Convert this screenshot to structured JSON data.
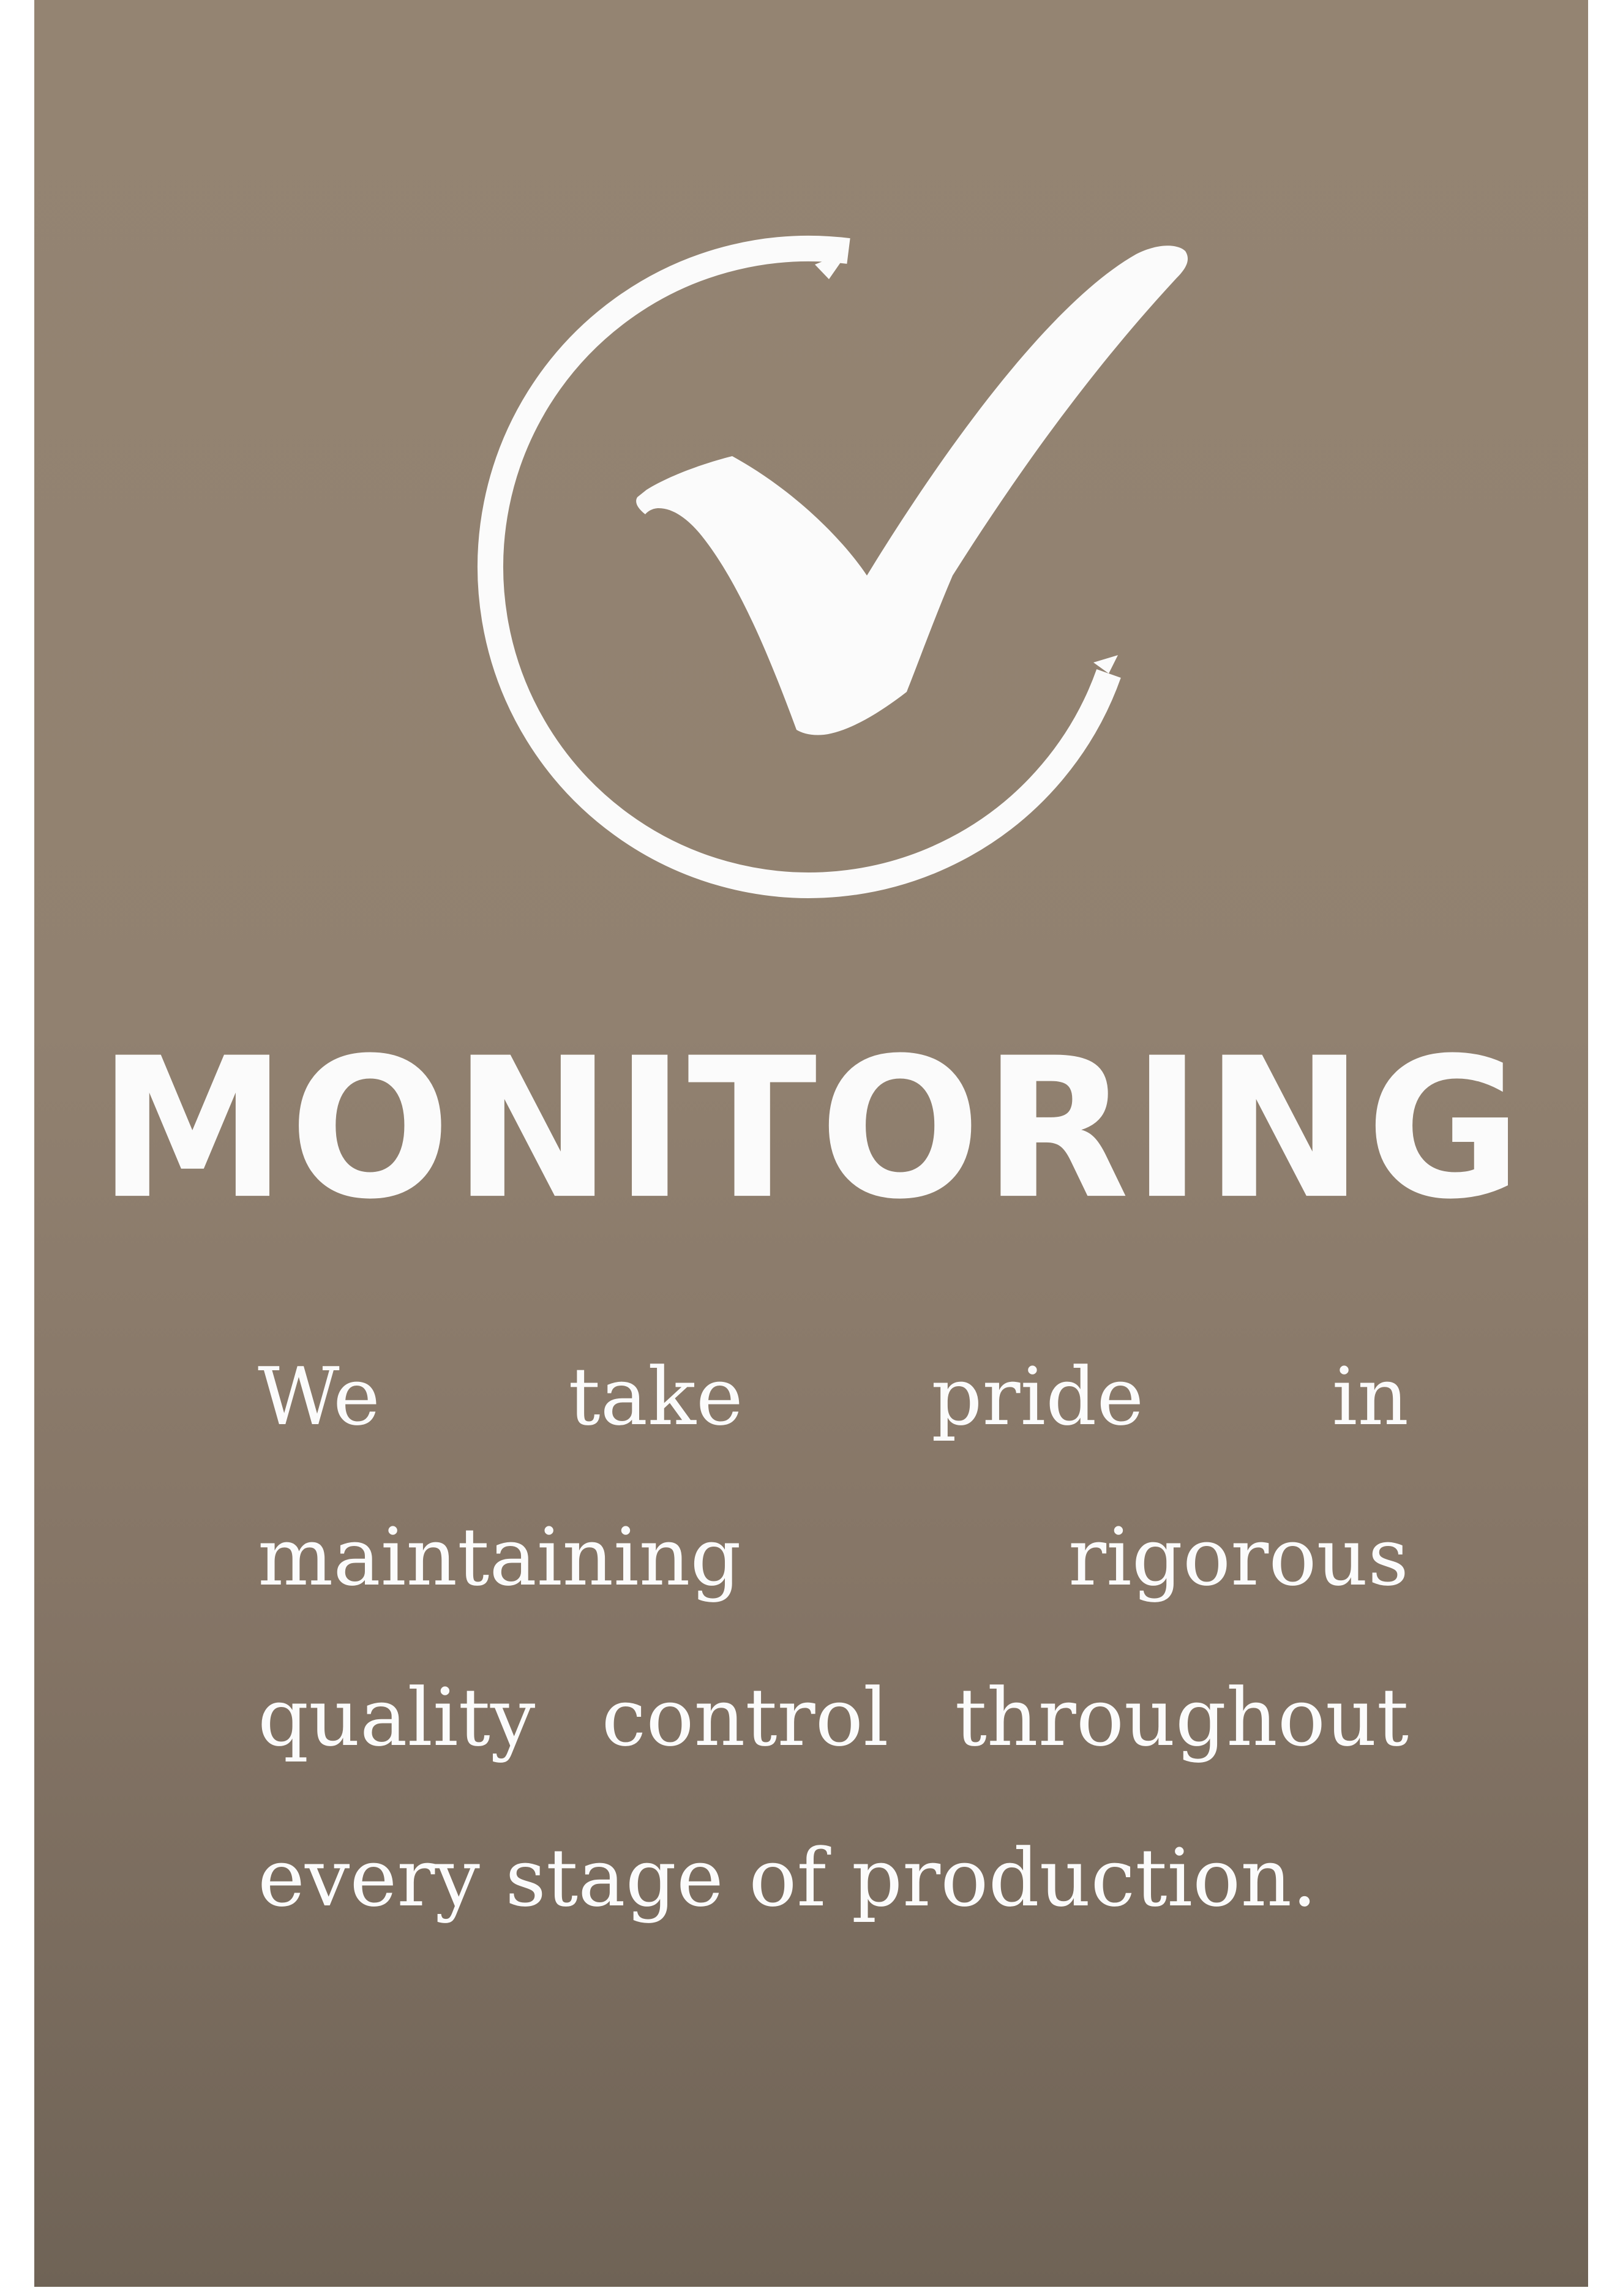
{
  "emblem": {
    "icon": "checkmark-in-circle-icon",
    "color": "#fbfbfb"
  },
  "colors": {
    "background_top": "#948472",
    "background_bottom": "#6f6356",
    "text": "#fbfbfb"
  },
  "title": "MONITORING",
  "description": "We take pride in maintaining rigorous quality control throughout every stage of production."
}
